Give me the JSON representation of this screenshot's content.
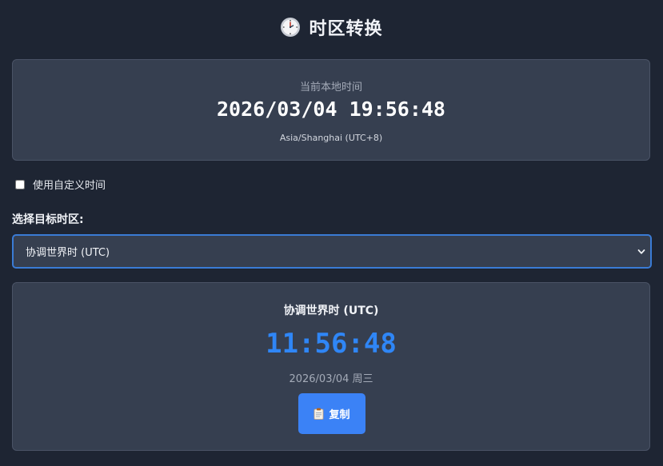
{
  "header": {
    "title": "时区转换",
    "icon": "clock-icon"
  },
  "local": {
    "label": "当前本地时间",
    "time": "2026/03/04 19:56:48",
    "zone": "Asia/Shanghai (UTC+8)"
  },
  "custom_time": {
    "label": "使用自定义时间",
    "checked": false
  },
  "target": {
    "label": "选择目标时区:",
    "selected": "协调世界时 (UTC)"
  },
  "result": {
    "zone_name": "协调世界时 (UTC)",
    "time": "11:56:48",
    "date": "2026/03/04 周三"
  },
  "copy_button": {
    "label": "复制",
    "icon": "clipboard-icon"
  },
  "colors": {
    "background": "#1e2533",
    "card": "#363f50",
    "accent": "#3b82f6",
    "result_time": "#2f86f6"
  }
}
